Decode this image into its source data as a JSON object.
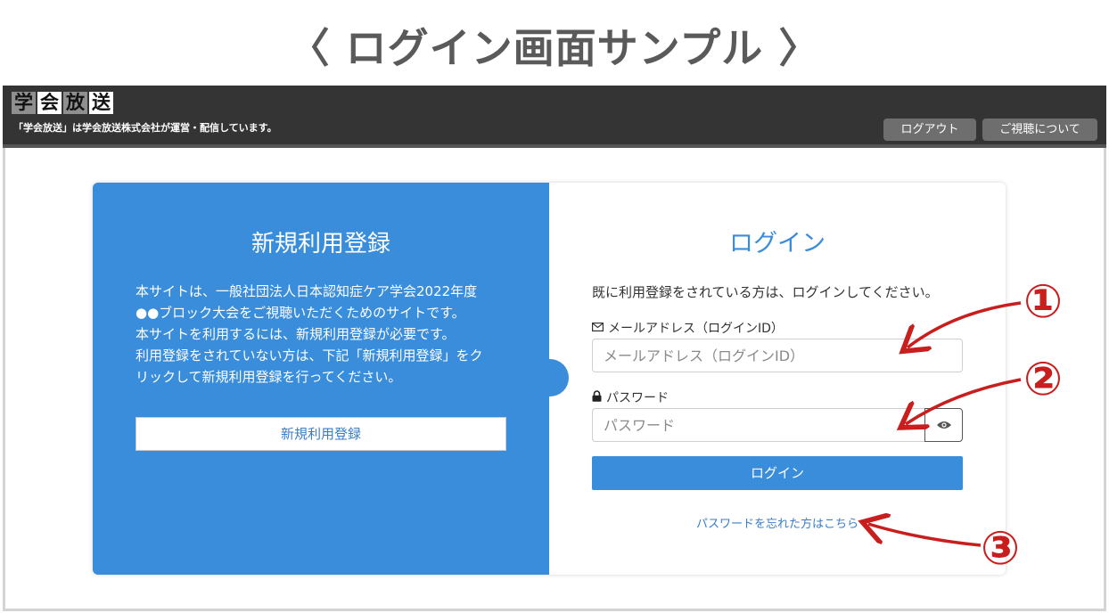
{
  "heading": "〈 ログイン画面サンプル 〉",
  "header": {
    "logo_chars": [
      "学",
      "会",
      "放",
      "送"
    ],
    "tagline": "「学会放送」は学会放送株式会社が運営・配信しています。",
    "logout_label": "ログアウト",
    "about_label": "ご視聴について"
  },
  "register": {
    "title": "新規利用登録",
    "description": "本サイトは、一般社団法人日本認知症ケア学会2022年度●●ブロック大会をご視聴いただくためのサイトです。本サイトを利用するには、新規利用登録が必要です。利用登録をされていない方は、下記「新規利用登録」をクリックして新規利用登録を行ってください。",
    "description_lines": [
      "本サイトは、一般社団法人日本認知症ケア学会2022年度",
      "●●ブロック大会をご視聴いただくためのサイトです。",
      "本サイトを利用するには、新規利用登録が必要です。",
      "利用登録をされていない方は、下記「新規利用登録」をク",
      "リックして新規利用登録を行ってください。"
    ],
    "button_label": "新規利用登録"
  },
  "login": {
    "title": "ログイン",
    "description": "既に利用登録をされている方は、ログインしてください。",
    "email_label": "メールアドレス（ログインID）",
    "email_placeholder": "メールアドレス（ログインID）",
    "email_value": "",
    "password_label": "パスワード",
    "password_placeholder": "パスワード",
    "password_value": "",
    "button_label": "ログイン",
    "forgot_label": "パスワードを忘れた方はこちら"
  },
  "annotations": [
    "①",
    "②",
    "③"
  ],
  "icons": {
    "email": "envelope-icon",
    "password": "lock-icon",
    "toggle": "eye-icon"
  },
  "colors": {
    "accent": "#3a8ddb",
    "header_bg": "#343434",
    "annotation": "#c81e1e"
  }
}
